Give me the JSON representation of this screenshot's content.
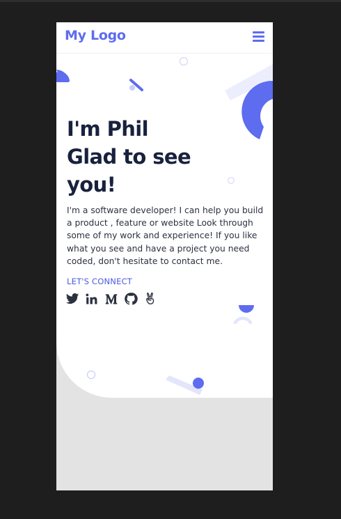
{
  "header": {
    "logo": "My Logo",
    "menu_icon": "hamburger-menu-icon"
  },
  "hero": {
    "headline": [
      "I'm Phil",
      "Glad to see",
      "you!"
    ],
    "intro": "I'm a software developer! I can help you build a product , feature or website Look through some of my work and experience! If you like what you see and have a project you need coded, don't hesitate to contact me.",
    "connect_label": "LET'S CONNECT"
  },
  "socials": [
    {
      "icon": "twitter-icon"
    },
    {
      "icon": "linkedin-icon"
    },
    {
      "icon": "medium-icon"
    },
    {
      "icon": "github-icon"
    },
    {
      "icon": "angellist-icon"
    }
  ],
  "colors": {
    "accent": "#5e6cf0",
    "accent_light": "#e9eafc",
    "heading": "#18213d",
    "body_text": "#2c3140",
    "lower_background": "#e3e3e3",
    "outer_background": "#1e1e1f"
  }
}
